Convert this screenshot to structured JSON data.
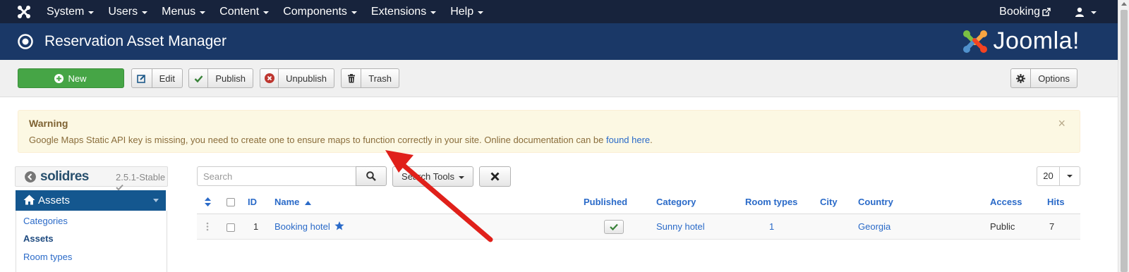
{
  "topnav": {
    "menus": [
      "System",
      "Users",
      "Menus",
      "Content",
      "Components",
      "Extensions",
      "Help"
    ],
    "booking_label": "Booking"
  },
  "header": {
    "title": "Reservation Asset Manager",
    "brand": "Joomla!"
  },
  "toolbar": {
    "new_label": "New",
    "edit_label": "Edit",
    "publish_label": "Publish",
    "unpublish_label": "Unpublish",
    "trash_label": "Trash",
    "options_label": "Options"
  },
  "alert": {
    "heading": "Warning",
    "message": "Google Maps Static API key is missing, you need to create one to ensure maps to function correctly in your site. Online documentation can be ",
    "link_text": "found here",
    "message_end": ".",
    "close_glyph": "×"
  },
  "sidebar": {
    "logo": "solidres",
    "version": "2.5.1-Stable",
    "section": "Assets",
    "items": [
      "Categories",
      "Assets",
      "Room types"
    ]
  },
  "search": {
    "placeholder": "Search",
    "tools_label": "Search Tools",
    "limit": "20"
  },
  "table": {
    "headers": {
      "id": "ID",
      "name": "Name",
      "published": "Published",
      "category": "Category",
      "room_types": "Room types",
      "city": "City",
      "country": "Country",
      "access": "Access",
      "hits": "Hits"
    },
    "rows": [
      {
        "id": "1",
        "name": "Booking hotel",
        "category": "Sunny hotel",
        "room_types": "1",
        "city": "",
        "country": "Georgia",
        "access": "Public",
        "hits": "7"
      }
    ]
  },
  "colors": {
    "navbar": "#17233c",
    "header": "#1a3867",
    "new_button": "#46a546",
    "link": "#2a6ac8",
    "warning_bg": "#fcf8e3",
    "arrow": "#e0201a"
  }
}
